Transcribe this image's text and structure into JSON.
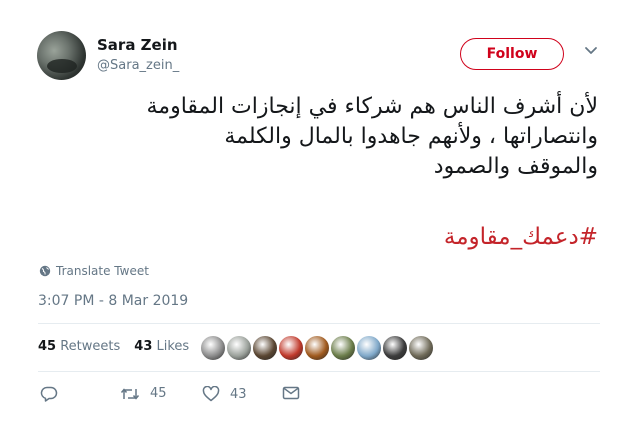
{
  "author": {
    "display_name": "Sara Zein",
    "handle": "@Sara_zein_",
    "avatar_icon": "profile-avatar"
  },
  "follow": {
    "label": "Follow",
    "accent_color": "#d0021b"
  },
  "menu": {
    "icon": "chevron-down-icon"
  },
  "tweet": {
    "text_lines": [
      "لأن أشرف الناس هم شركاء في إنجازات المقاومة",
      "وانتصاراتها ، ولأنهم جاهدوا بالمال والكلمة",
      "والموقف والصمود"
    ],
    "hashtag": "#دعمك_مقاومة",
    "hashtag_color": "#c4242a"
  },
  "translate": {
    "label": "Translate Tweet",
    "icon": "globe-icon"
  },
  "timestamp": "3:07 PM - 8 Mar 2019",
  "stats": {
    "retweets_count": "45",
    "retweets_label": "Retweets",
    "likes_count": "43",
    "likes_label": "Likes"
  },
  "likers": [
    {
      "name": "liker-avatar-1",
      "color": "#8c8c8c"
    },
    {
      "name": "liker-avatar-2",
      "color": "#9aa09a"
    },
    {
      "name": "liker-avatar-3",
      "color": "#5a4632"
    },
    {
      "name": "liker-avatar-4",
      "color": "#c0392b"
    },
    {
      "name": "liker-avatar-5",
      "color": "#a05a1e"
    },
    {
      "name": "liker-avatar-6",
      "color": "#6b7d4a"
    },
    {
      "name": "liker-avatar-7",
      "color": "#7fa8c9"
    },
    {
      "name": "liker-avatar-8",
      "color": "#3c3c3c"
    },
    {
      "name": "liker-avatar-9",
      "color": "#6f6a58"
    }
  ],
  "actions": {
    "reply_icon": "reply-icon",
    "retweet_icon": "retweet-icon",
    "retweet_count": "45",
    "like_icon": "heart-icon",
    "like_count": "43",
    "message_icon": "mail-icon"
  }
}
